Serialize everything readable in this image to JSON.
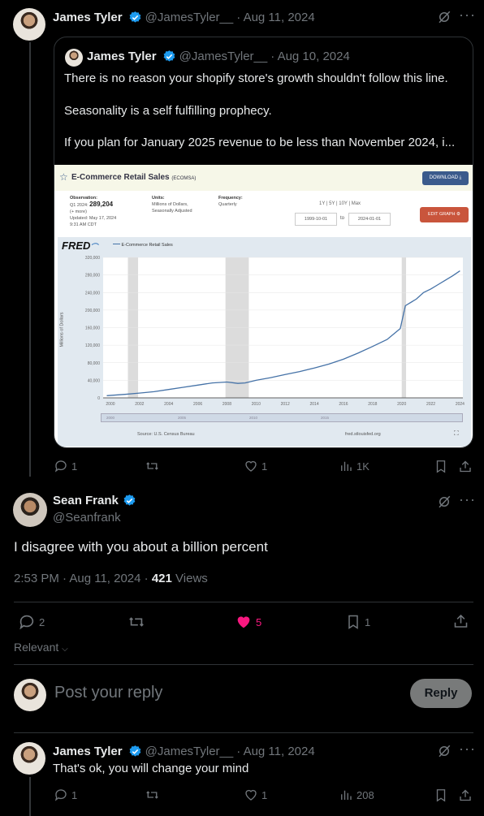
{
  "post1": {
    "name": "James Tyler",
    "handle": "@JamesTyler__",
    "date": "· Aug 11, 2024",
    "replies": "1",
    "likes": "1",
    "views": "1K"
  },
  "quote": {
    "name": "James Tyler",
    "handle": "@JamesTyler__",
    "date": "· Aug 10, 2024",
    "line1": "There is no reason your shopify store's growth shouldn't follow this line.",
    "line2": "Seasonality is a self fulfilling prophecy.",
    "line3": "If you plan for January 2025 revenue to be less than November 2024, i..."
  },
  "fred": {
    "title": "E-Commerce Retail Sales",
    "code": "(ECOMSA)",
    "download": "DOWNLOAD",
    "obs_label": "Observation:",
    "obs_period": "Q1 2024:",
    "obs_value": "289,204",
    "obs_more": "(+ more)",
    "updated": "Updated: May 17, 2024",
    "updated_time": "9:31 AM CDT",
    "units_label": "Units:",
    "units_1": "Millions of Dollars,",
    "units_2": "Seasonally Adjusted",
    "freq_label": "Frequency:",
    "freq": "Quarterly",
    "ranges": "1Y | 5Y | 10Y | Max",
    "date_from": "1999-10-01",
    "to": "to",
    "date_to": "2024-01-01",
    "edit": "EDIT GRAPH",
    "logo": "FRED",
    "legend": "E-Commerce Retail Sales",
    "source": "Source: U.S. Census Bureau",
    "site": "fred.stlouisfed.org",
    "ylabel": "Millions of Dollars",
    "mini_years": [
      "2000",
      "2005",
      "2010",
      "2015"
    ]
  },
  "chart_data": {
    "type": "line",
    "title": "",
    "ylabel": "Millions of Dollars",
    "ylim": [
      0,
      320000
    ],
    "y_ticks": [
      "320,000",
      "280,000",
      "240,000",
      "200,000",
      "160,000",
      "120,000",
      "80,000",
      "40,000",
      "0"
    ],
    "x_ticks": [
      "2000",
      "2002",
      "2004",
      "2006",
      "2008",
      "2010",
      "2012",
      "2014",
      "2016",
      "2018",
      "2020",
      "2022",
      "2024"
    ],
    "series": [
      {
        "name": "E-Commerce Retail Sales",
        "x": [
          1999.75,
          2001,
          2002,
          2003,
          2004,
          2005,
          2006,
          2007,
          2008,
          2008.75,
          2009.25,
          2010,
          2011,
          2012,
          2013,
          2014,
          2015,
          2016,
          2017,
          2018,
          2019,
          2019.9,
          2020.25,
          2020.5,
          2021,
          2021.5,
          2022,
          2022.5,
          2023,
          2023.5,
          2024
        ],
        "values": [
          5000,
          8000,
          11000,
          14000,
          19000,
          24000,
          29000,
          34000,
          36000,
          33000,
          34000,
          40000,
          46000,
          53000,
          60000,
          68000,
          77000,
          88000,
          102000,
          117000,
          133000,
          158000,
          210000,
          215000,
          225000,
          240000,
          248000,
          258000,
          268000,
          278000,
          289204
        ]
      }
    ],
    "recessions": [
      [
        2001.2,
        2001.9
      ],
      [
        2007.9,
        2009.5
      ],
      [
        2020.0,
        2020.3
      ]
    ],
    "grid": true
  },
  "post2": {
    "name": "Sean Frank",
    "handle": "@Seanfrank",
    "text": "I disagree with you about a billion percent",
    "time": "2:53 PM · Aug 11, 2024 ·",
    "views_count": "421",
    "views_label": "Views",
    "replies": "2",
    "likes": "5",
    "bookmarks": "1"
  },
  "sort": {
    "label": "Relevant"
  },
  "reply_box": {
    "placeholder": "Post your reply",
    "button": "Reply"
  },
  "post3": {
    "name": "James Tyler",
    "handle": "@JamesTyler__",
    "date": "· Aug 11, 2024",
    "text": "That's ok, you will change your mind",
    "replies": "1",
    "likes": "1",
    "views": "208"
  },
  "colors": {
    "accent": "#1d9bf0",
    "like": "#f91880",
    "reply_btn": "#eff3f4"
  }
}
